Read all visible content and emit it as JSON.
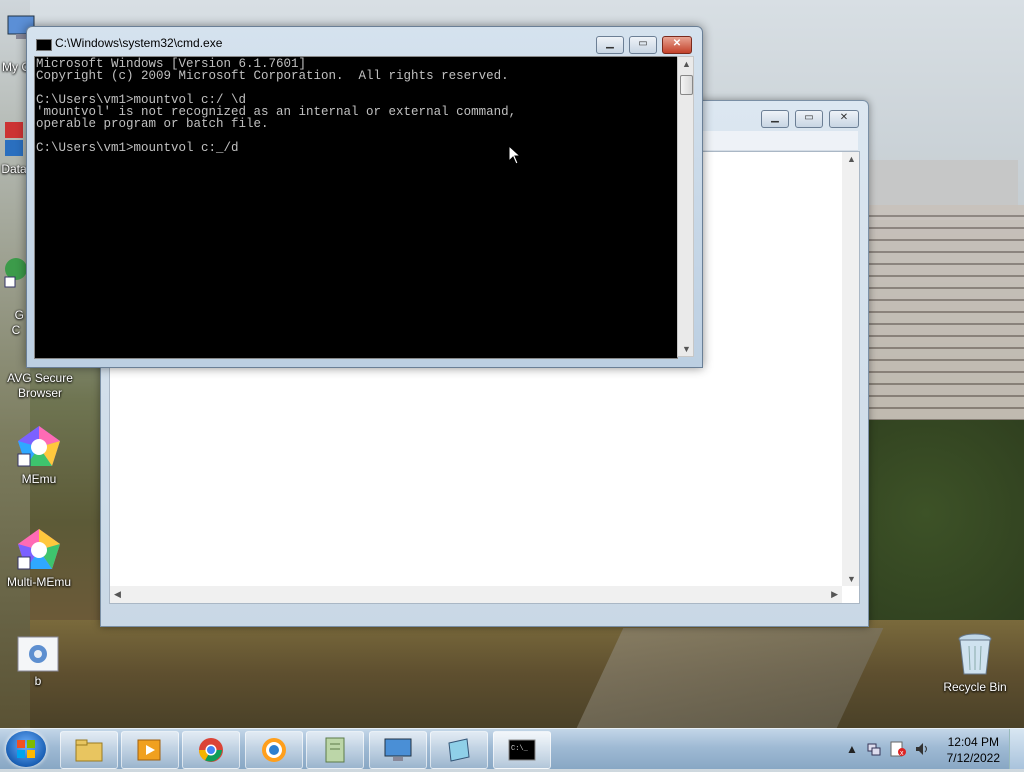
{
  "desktop": {
    "icons": [
      {
        "label": "My C"
      },
      {
        "label": "Data"
      },
      {
        "label": "G\nC"
      },
      {
        "label": "AVG Secure Browser"
      },
      {
        "label": "MEmu"
      },
      {
        "label": "Multi-MEmu"
      },
      {
        "label": "b"
      },
      {
        "label": "Recycle Bin"
      }
    ]
  },
  "cmd_window": {
    "title": "C:\\Windows\\system32\\cmd.exe",
    "console_text": "Microsoft Windows [Version 6.1.7601]\nCopyright (c) 2009 Microsoft Corporation.  All rights reserved.\n\nC:\\Users\\vm1>mountvol c:/ \\d\n'mountvol' is not recognized as an internal or external command,\noperable program or batch file.\n\nC:\\Users\\vm1>mountvol c:_/d",
    "buttons": {
      "minimize": "▁",
      "maximize": "▭",
      "close": "✕"
    }
  },
  "background_window": {
    "buttons": {
      "minimize": "▁",
      "maximize": "▭",
      "close": "✕"
    }
  },
  "taskbar": {
    "apps": [
      "file-explorer",
      "media-player",
      "chrome",
      "avg-browser",
      "document-viewer",
      "remote-desktop",
      "notepad",
      "command-prompt"
    ],
    "clock_time": "12:04 PM",
    "clock_date": "7/12/2022"
  }
}
